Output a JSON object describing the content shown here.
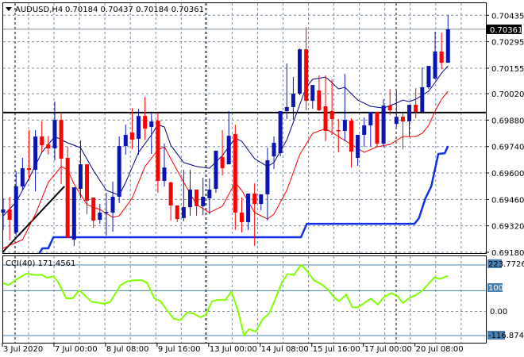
{
  "header": {
    "symbol": "AUDUSD,H4",
    "ohlc": "0.70184 0.70437 0.70184 0.70361"
  },
  "price_axis": {
    "labels": [
      "0.70435",
      "0.70295",
      "0.70155",
      "0.70020",
      "0.69880",
      "0.69740",
      "0.69600",
      "0.69460",
      "0.69320",
      "0.69180"
    ],
    "values": [
      0.70435,
      0.70295,
      0.70155,
      0.7002,
      0.6988,
      0.6974,
      0.696,
      0.6946,
      0.6932,
      0.6918
    ],
    "current_price": "0.70361",
    "current_value": 0.70361
  },
  "indicator": {
    "title": "CCI(40) 171.4561",
    "max_label": "223.7726",
    "level_high_label": "100",
    "zero_label": "0.00",
    "min_label": "-116.8746",
    "max": 223.7726,
    "min": -116.8746
  },
  "time_axis": {
    "labels": [
      "3 Jul 2020",
      "7 Jul 00:00",
      "8 Jul 08:00",
      "9 Jul 16:00",
      "13 Jul 00:00",
      "14 Jul 08:00",
      "15 Jul 16:00",
      "17 Jul 00:00",
      "20 Jul 08:00"
    ],
    "label_bar_index": [
      0,
      8,
      16,
      24,
      32,
      40,
      48,
      56,
      64
    ]
  },
  "colors": {
    "bull": "#0a14b4",
    "bear": "#ff0000",
    "ma_fast": "#000080",
    "ma_slow": "#ff0000",
    "support_step": "#1030e6",
    "cci": "#80ff00",
    "cci_levels": "#4682b4",
    "grid": "#7f8c99"
  },
  "chart_data": [
    {
      "type": "candlestick",
      "title": "AUDUSD,H4",
      "ylim": [
        0.6918,
        0.70437
      ],
      "ohlc": [
        [
          0.6939,
          0.69466,
          0.69298,
          0.69407
        ],
        [
          0.69407,
          0.69474,
          0.69243,
          0.69352
        ],
        [
          0.69285,
          0.69608,
          0.69268,
          0.69529
        ],
        [
          0.69529,
          0.6968,
          0.69508,
          0.69625
        ],
        [
          0.69625,
          0.69827,
          0.69562,
          0.69617
        ],
        [
          0.69617,
          0.69827,
          0.69503,
          0.69793
        ],
        [
          0.69793,
          0.69873,
          0.69709,
          0.69747
        ],
        [
          0.69751,
          0.69797,
          0.69697,
          0.6973
        ],
        [
          0.6973,
          0.69978,
          0.69667,
          0.69881
        ],
        [
          0.69881,
          0.69919,
          0.69541,
          0.69676
        ],
        [
          0.6968,
          0.69739,
          0.69256,
          0.69256
        ],
        [
          0.69247,
          0.69524,
          0.69214,
          0.69524
        ],
        [
          0.69516,
          0.69772,
          0.69466,
          0.69646
        ],
        [
          0.69646,
          0.69646,
          0.69382,
          0.69453
        ],
        [
          0.6947,
          0.6947,
          0.6931,
          0.69348
        ],
        [
          0.69352,
          0.69436,
          0.69331,
          0.6939
        ],
        [
          0.6939,
          0.69495,
          0.69268,
          0.69394
        ],
        [
          0.6939,
          0.69554,
          0.69289,
          0.69474
        ],
        [
          0.69474,
          0.69793,
          0.6944,
          0.69743
        ],
        [
          0.69743,
          0.69856,
          0.69697,
          0.69802
        ],
        [
          0.69814,
          0.69944,
          0.69726,
          0.69776
        ],
        [
          0.69781,
          0.6994,
          0.69697,
          0.69902
        ],
        [
          0.69902,
          0.70003,
          0.69776,
          0.69835
        ],
        [
          0.69844,
          0.69919,
          0.69701,
          0.69873
        ],
        [
          0.69877,
          0.69919,
          0.69495,
          0.69558
        ],
        [
          0.69558,
          0.69755,
          0.69529,
          0.69629
        ],
        [
          0.6955,
          0.69554,
          0.69348,
          0.69428
        ],
        [
          0.69428,
          0.69428,
          0.6934,
          0.69356
        ],
        [
          0.69361,
          0.69617,
          0.69344,
          0.69419
        ],
        [
          0.69419,
          0.69617,
          0.69373,
          0.69512
        ],
        [
          0.69512,
          0.69512,
          0.69373,
          0.69424
        ],
        [
          0.69424,
          0.69575,
          0.69377,
          0.69474
        ],
        [
          0.69466,
          0.69571,
          0.69382,
          0.69512
        ],
        [
          0.69516,
          0.69718,
          0.69495,
          0.69718
        ],
        [
          0.69684,
          0.69827,
          0.69587,
          0.69625
        ],
        [
          0.69646,
          0.69928,
          0.69646,
          0.69797
        ],
        [
          0.69806,
          0.69856,
          0.69298,
          0.6939
        ],
        [
          0.6939,
          0.6947,
          0.69285,
          0.6934
        ],
        [
          0.6934,
          0.69491,
          0.69298,
          0.69491
        ],
        [
          0.69491,
          0.69545,
          0.69214,
          0.69436
        ],
        [
          0.69436,
          0.69487,
          0.69403,
          0.69487
        ],
        [
          0.69487,
          0.69734,
          0.69348,
          0.69667
        ],
        [
          0.69688,
          0.69793,
          0.69621,
          0.6976
        ],
        [
          0.69705,
          0.69928,
          0.69688,
          0.69928
        ],
        [
          0.69928,
          0.7018,
          0.69886,
          0.69949
        ],
        [
          0.69949,
          0.70108,
          0.69881,
          0.7002
        ],
        [
          0.7002,
          0.70259,
          0.70012,
          0.70255
        ],
        [
          0.70255,
          0.70373,
          0.69932,
          0.69982
        ],
        [
          0.69982,
          0.70066,
          0.6994,
          0.70066
        ],
        [
          0.70037,
          0.70117,
          0.69928,
          0.69932
        ],
        [
          0.69953,
          0.70117,
          0.69768,
          0.69823
        ],
        [
          0.69928,
          0.70096,
          0.69802,
          0.69886
        ],
        [
          0.69827,
          0.69886,
          0.69709,
          0.69823
        ],
        [
          0.69823,
          0.70125,
          0.69768,
          0.69881
        ],
        [
          0.69877,
          0.6989,
          0.69629,
          0.69713
        ],
        [
          0.6968,
          0.69802,
          0.69638,
          0.69802
        ],
        [
          0.69802,
          0.69894,
          0.69739,
          0.69852
        ],
        [
          0.69852,
          0.69923,
          0.69739,
          0.69923
        ],
        [
          0.69923,
          0.69923,
          0.69739,
          0.69755
        ],
        [
          0.69755,
          0.69991,
          0.69734,
          0.69957
        ],
        [
          0.69957,
          0.70045,
          0.69907,
          0.69932
        ],
        [
          0.6986,
          0.70033,
          0.69844,
          0.69898
        ],
        [
          0.69898,
          0.69915,
          0.69726,
          0.69873
        ],
        [
          0.69873,
          0.69961,
          0.69793,
          0.69961
        ],
        [
          0.69961,
          0.70049,
          0.6989,
          0.69923
        ],
        [
          0.69923,
          0.70159,
          0.69923,
          0.70054
        ],
        [
          0.70054,
          0.70167,
          0.70045,
          0.70167
        ],
        [
          0.701,
          0.70348,
          0.70096,
          0.70243
        ],
        [
          0.70243,
          0.70343,
          0.7015,
          0.70184
        ],
        [
          0.70184,
          0.70437,
          0.70184,
          0.70361
        ]
      ],
      "ma_fast": [
        [
          0,
          0.69373
        ],
        [
          2,
          0.69445
        ],
        [
          4,
          0.69571
        ],
        [
          6,
          0.69709
        ],
        [
          8,
          0.69793
        ],
        [
          10,
          0.6976
        ],
        [
          12,
          0.69734
        ],
        [
          14,
          0.69613
        ],
        [
          16,
          0.69508
        ],
        [
          18,
          0.69482
        ],
        [
          19,
          0.6955
        ],
        [
          21,
          0.69709
        ],
        [
          23,
          0.69802
        ],
        [
          24,
          0.69856
        ],
        [
          25,
          0.69844
        ],
        [
          26,
          0.69747
        ],
        [
          28,
          0.69655
        ],
        [
          30,
          0.69634
        ],
        [
          32,
          0.69625
        ],
        [
          34,
          0.69692
        ],
        [
          36,
          0.69785
        ],
        [
          37,
          0.69768
        ],
        [
          39,
          0.69676
        ],
        [
          41,
          0.69634
        ],
        [
          42,
          0.69655
        ],
        [
          44,
          0.69776
        ],
        [
          46,
          0.69961
        ],
        [
          47,
          0.70054
        ],
        [
          48,
          0.70096
        ],
        [
          50,
          0.70108
        ],
        [
          51,
          0.70079
        ],
        [
          52,
          0.70045
        ],
        [
          53,
          0.70054
        ],
        [
          55,
          0.69986
        ],
        [
          57,
          0.69953
        ],
        [
          59,
          0.69944
        ],
        [
          61,
          0.6997
        ],
        [
          62,
          0.69986
        ],
        [
          63,
          0.69978
        ],
        [
          64,
          0.69991
        ],
        [
          66,
          0.70033
        ],
        [
          67,
          0.70079
        ],
        [
          68,
          0.70129
        ],
        [
          69,
          0.70167
        ]
      ],
      "ma_slow": [
        [
          0,
          0.69201
        ],
        [
          3,
          0.69247
        ],
        [
          5,
          0.69382
        ],
        [
          7,
          0.6955
        ],
        [
          9,
          0.69634
        ],
        [
          10,
          0.69617
        ],
        [
          11,
          0.69541
        ],
        [
          13,
          0.69432
        ],
        [
          15,
          0.69407
        ],
        [
          17,
          0.69365
        ],
        [
          18,
          0.69373
        ],
        [
          20,
          0.69466
        ],
        [
          22,
          0.69634
        ],
        [
          24,
          0.69722
        ],
        [
          25,
          0.69739
        ],
        [
          26,
          0.69676
        ],
        [
          28,
          0.6955
        ],
        [
          30,
          0.69432
        ],
        [
          32,
          0.6939
        ],
        [
          34,
          0.69424
        ],
        [
          36,
          0.6955
        ],
        [
          37,
          0.69508
        ],
        [
          39,
          0.6939
        ],
        [
          41,
          0.69356
        ],
        [
          42,
          0.69382
        ],
        [
          44,
          0.69508
        ],
        [
          46,
          0.69697
        ],
        [
          48,
          0.6981
        ],
        [
          50,
          0.69835
        ],
        [
          52,
          0.69793
        ],
        [
          54,
          0.69751
        ],
        [
          56,
          0.69709
        ],
        [
          58,
          0.69739
        ],
        [
          60,
          0.69751
        ],
        [
          62,
          0.69793
        ],
        [
          64,
          0.69793
        ],
        [
          65,
          0.6981
        ],
        [
          66,
          0.69852
        ],
        [
          67,
          0.69928
        ],
        [
          68,
          0.69991
        ],
        [
          69,
          0.70033
        ]
      ],
      "support_step": [
        [
          5.6,
          0.69176
        ],
        [
          6.1,
          0.69201
        ],
        [
          7.0,
          0.69201
        ],
        [
          7.8,
          0.6926
        ],
        [
          46.2,
          0.6926
        ],
        [
          47.1,
          0.69331
        ],
        [
          63.8,
          0.69331
        ],
        [
          64.5,
          0.69361
        ],
        [
          65.5,
          0.69466
        ],
        [
          66.4,
          0.69529
        ],
        [
          67.5,
          0.69701
        ],
        [
          68.5,
          0.69705
        ],
        [
          69,
          0.69743
        ]
      ],
      "horizontal_level": 0.6992,
      "trendline": [
        [
          -0.1,
          0.6918
        ],
        [
          9.5,
          0.69529
        ]
      ]
    },
    {
      "type": "line",
      "title": "CCI(40) 171.4561",
      "ylim": [
        -116.8746,
        223.7726
      ],
      "levels": [
        100,
        0
      ],
      "points": [
        [
          -0.1,
          138
        ],
        [
          0.8,
          126
        ],
        [
          1.84,
          150
        ],
        [
          3.66,
          183
        ],
        [
          4.7,
          176
        ],
        [
          6.0,
          176
        ],
        [
          6.77,
          162
        ],
        [
          7.8,
          169
        ],
        [
          8.58,
          138
        ],
        [
          9.77,
          63
        ],
        [
          10.8,
          63
        ],
        [
          11.8,
          102
        ],
        [
          13.77,
          45
        ],
        [
          14.5,
          43
        ],
        [
          15.58,
          37
        ],
        [
          16.6,
          45
        ],
        [
          18.2,
          126
        ],
        [
          19.2,
          144
        ],
        [
          20.25,
          150
        ],
        [
          21.54,
          150
        ],
        [
          22.3,
          138
        ],
        [
          23.46,
          63
        ],
        [
          24.4,
          49
        ],
        [
          25.43,
          5
        ],
        [
          26.47,
          -35
        ],
        [
          27.5,
          -43
        ],
        [
          28.54,
          -5
        ],
        [
          29.58,
          -11
        ],
        [
          30.6,
          -29
        ],
        [
          31.39,
          -17
        ],
        [
          32.4,
          49
        ],
        [
          33.2,
          55
        ],
        [
          34.5,
          55
        ],
        [
          35.4,
          96
        ],
        [
          36.4,
          7
        ],
        [
          37.35,
          -116.87
        ],
        [
          38.13,
          -86
        ],
        [
          39.17,
          -98
        ],
        [
          40.2,
          -40
        ],
        [
          41.24,
          -11
        ],
        [
          42.0,
          43
        ],
        [
          43.3,
          144
        ],
        [
          44.1,
          180
        ],
        [
          45.1,
          176
        ],
        [
          46.2,
          223.77
        ],
        [
          46.9,
          204
        ],
        [
          48.2,
          150
        ],
        [
          49.3,
          132
        ],
        [
          50.3,
          108
        ],
        [
          51.35,
          67
        ],
        [
          52.1,
          49
        ],
        [
          53.2,
          81
        ],
        [
          54.2,
          19
        ],
        [
          55.0,
          19
        ],
        [
          57.0,
          61
        ],
        [
          58.1,
          33
        ],
        [
          59.1,
          69
        ],
        [
          60.2,
          88
        ],
        [
          61.2,
          73
        ],
        [
          62.0,
          40
        ],
        [
          63.0,
          64
        ],
        [
          64.05,
          79
        ],
        [
          65.1,
          102
        ],
        [
          66.9,
          164
        ],
        [
          67.7,
          156
        ],
        [
          69.0,
          171.46
        ]
      ]
    }
  ]
}
